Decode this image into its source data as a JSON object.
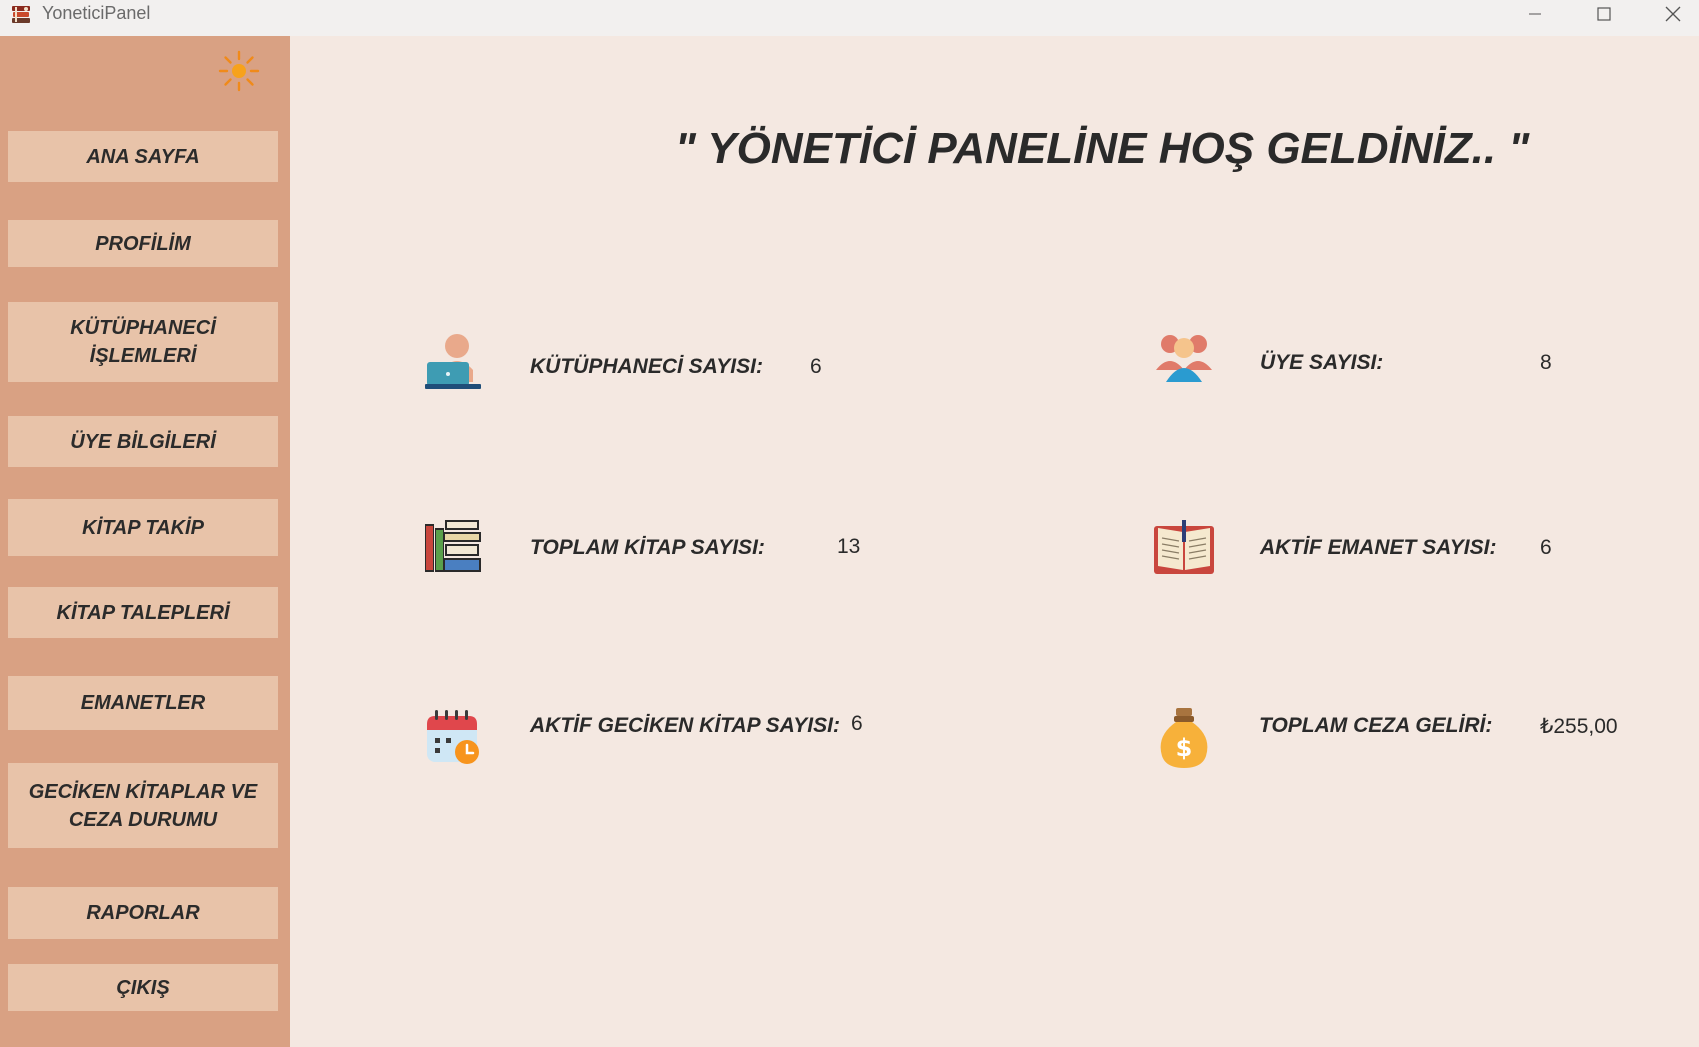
{
  "window": {
    "title": "YoneticiPanel"
  },
  "sidebar": {
    "theme_toggle_icon": "sun-icon",
    "items": [
      {
        "id": "ana-sayfa",
        "label": "ANA SAYFA"
      },
      {
        "id": "profilim",
        "label": "PROFİLİM"
      },
      {
        "id": "kutuphaneci-islemleri",
        "label": "KÜTÜPHANECİ İŞLEMLERİ"
      },
      {
        "id": "uye-bilgileri",
        "label": "ÜYE BİLGİLERİ"
      },
      {
        "id": "kitap-takip",
        "label": "KİTAP TAKİP"
      },
      {
        "id": "kitap-talepleri",
        "label": "KİTAP TALEPLERİ"
      },
      {
        "id": "emanetler",
        "label": "EMANETLER"
      },
      {
        "id": "geciken-kitaplar",
        "label": "GECİKEN KİTAPLAR VE CEZA DURUMU"
      },
      {
        "id": "raporlar",
        "label": "RAPORLAR"
      },
      {
        "id": "cikis",
        "label": "ÇIKIŞ"
      }
    ]
  },
  "main": {
    "welcome": "\" YÖNETİCİ PANELİNE HOŞ GELDİNİZ.. \"",
    "stats": [
      {
        "id": "kutuphaneci",
        "icon": "librarian-icon",
        "label": "KÜTÜPHANECİ SAYISI:",
        "value": "6"
      },
      {
        "id": "uye",
        "icon": "members-icon",
        "label": "ÜYE SAYISI:",
        "value": "8"
      },
      {
        "id": "toplam-kitap",
        "icon": "books-icon",
        "label": "TOPLAM KİTAP SAYISI:",
        "value": "13"
      },
      {
        "id": "aktif-emanet",
        "icon": "open-book-icon",
        "label": "AKTİF EMANET SAYISI:",
        "value": "6"
      },
      {
        "id": "aktif-geciken",
        "icon": "calendar-clock-icon",
        "label": "AKTİF GECİKEN KİTAP SAYISI:",
        "value": "6"
      },
      {
        "id": "toplam-ceza",
        "icon": "money-bag-icon",
        "label": "TOPLAM CEZA GELİRİ:",
        "value": "₺255,00"
      }
    ]
  },
  "colors": {
    "sidebar_bg": "#d9a183",
    "button_bg": "#e8c3a9",
    "main_bg": "#f4e8e1",
    "titlebar_bg": "#f2f0ef",
    "text": "#2a2a2a"
  }
}
